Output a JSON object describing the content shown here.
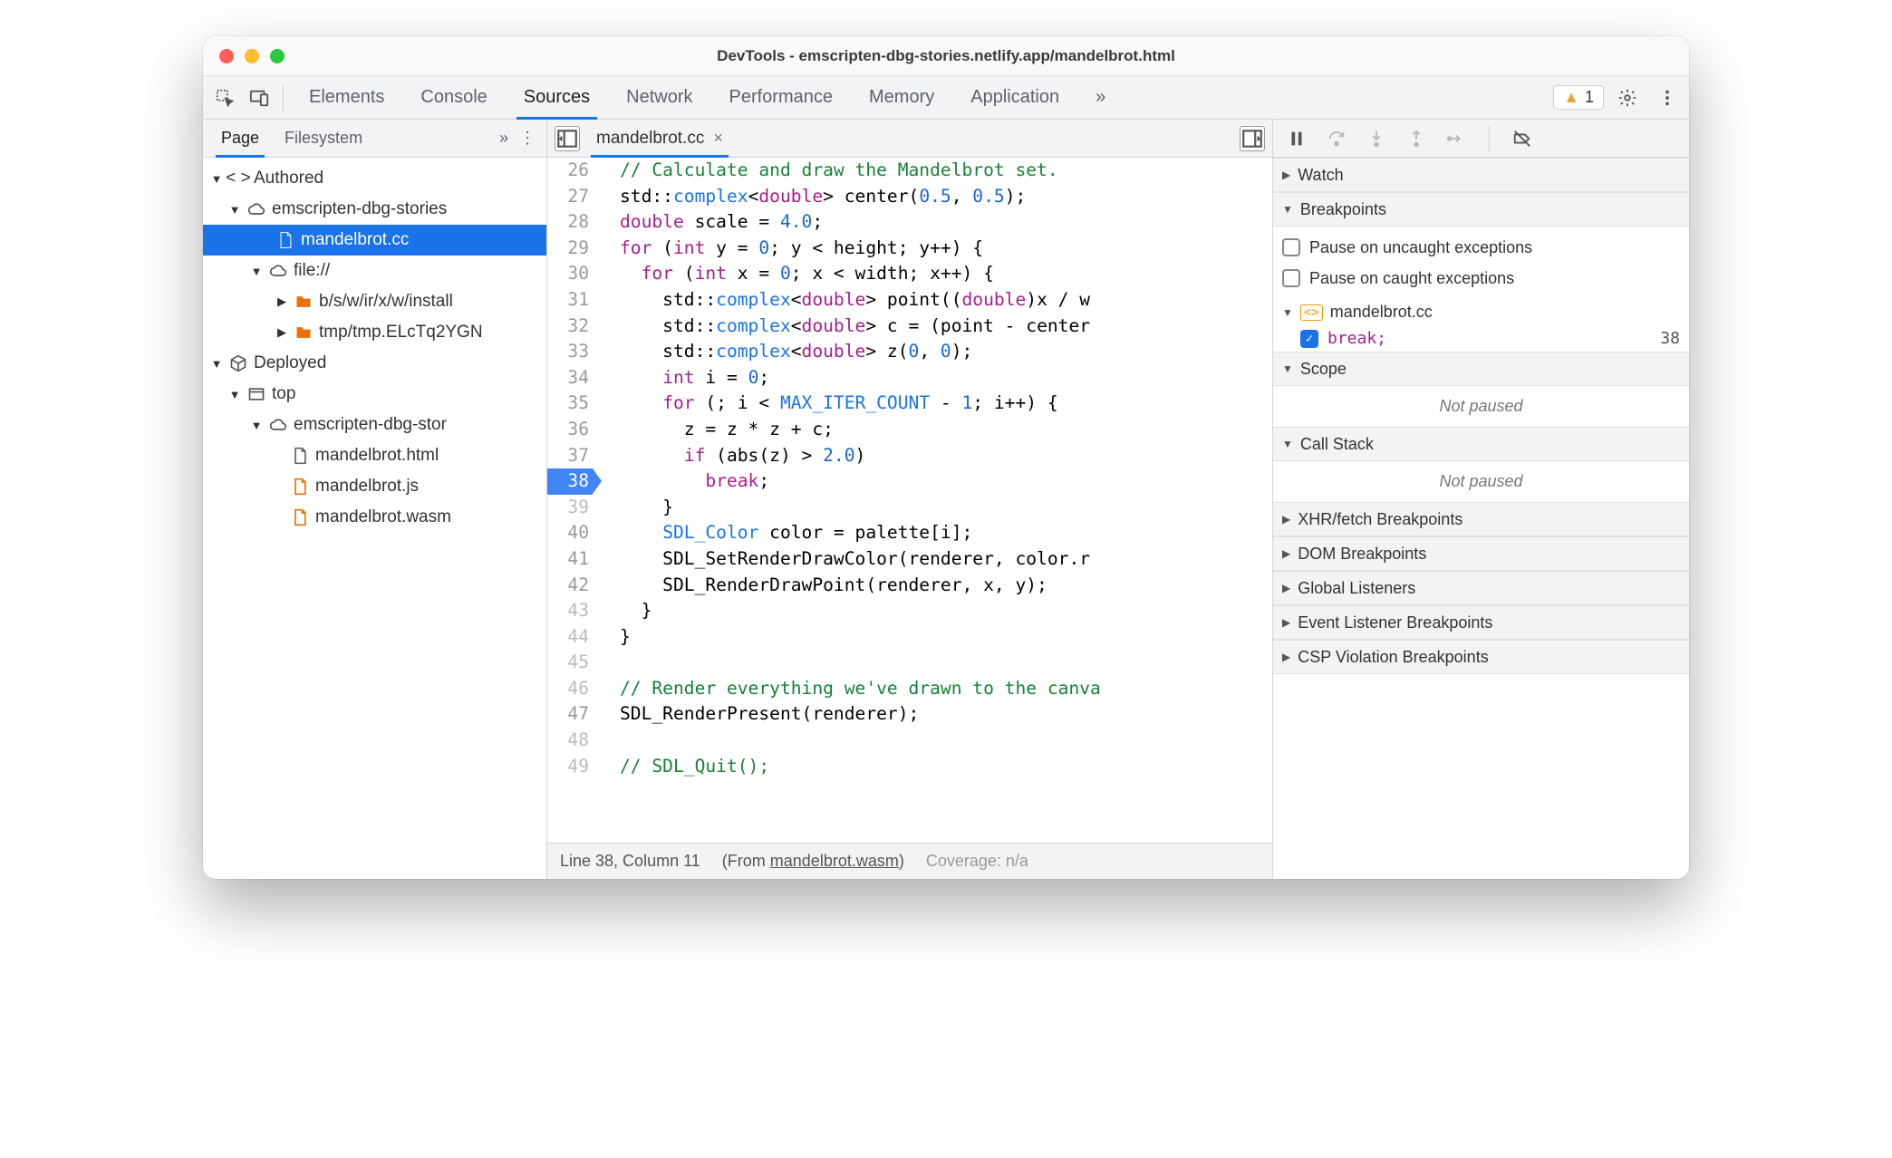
{
  "title": "DevTools - emscripten-dbg-stories.netlify.app/mandelbrot.html",
  "toolbar": {
    "panels": [
      "Elements",
      "Console",
      "Sources",
      "Network",
      "Performance",
      "Memory",
      "Application"
    ],
    "active": "Sources",
    "overflow": "»",
    "warning_count": "1"
  },
  "sidebar": {
    "tabs": [
      "Page",
      "Filesystem"
    ],
    "active": "Page",
    "overflow": "»",
    "tree": {
      "authored_label": "Authored",
      "origin1": "emscripten-dbg-stories",
      "file_sel": "mandelbrot.cc",
      "file_scheme": "file://",
      "dirs": [
        "b/s/w/ir/x/w/install",
        "tmp/tmp.ELcTq2YGN"
      ],
      "deployed_label": "Deployed",
      "top_label": "top",
      "origin2": "emscripten-dbg-stor",
      "deployed_files": [
        "mandelbrot.html",
        "mandelbrot.js",
        "mandelbrot.wasm"
      ]
    }
  },
  "editor": {
    "tab_name": "mandelbrot.cc",
    "status_lc": "Line 38, Column 11",
    "status_from_prefix": "(From ",
    "status_from_link": "mandelbrot.wasm",
    "status_from_suffix": ")",
    "status_cov": "Coverage: n/a",
    "first_line": 26,
    "breakpoint_line": 38,
    "dim_lines": [
      39,
      43,
      44,
      45,
      46,
      48,
      49
    ],
    "code": [
      {
        "n": 26,
        "h": "<span class='c-cm'>// Calculate and draw the Mandelbrot set.</span>"
      },
      {
        "n": 27,
        "h": "std::<span class='c-ty'>complex</span>&lt;<span class='c-kw'>double</span>&gt; center(<span class='c-num'>0.5</span>, <span class='c-num'>0.5</span>);"
      },
      {
        "n": 28,
        "h": "<span class='c-kw'>double</span> scale = <span class='c-num'>4.0</span>;"
      },
      {
        "n": 29,
        "h": "<span class='c-kw'>for</span> (<span class='c-kw'>int</span> y = <span class='c-num'>0</span>; y &lt; height; y++) {"
      },
      {
        "n": 30,
        "h": "  <span class='c-kw'>for</span> (<span class='c-kw'>int</span> x = <span class='c-num'>0</span>; x &lt; width; x++) {"
      },
      {
        "n": 31,
        "h": "    std::<span class='c-ty'>complex</span>&lt;<span class='c-kw'>double</span>&gt; point((<span class='c-kw'>double</span>)x / w"
      },
      {
        "n": 32,
        "h": "    std::<span class='c-ty'>complex</span>&lt;<span class='c-kw'>double</span>&gt; c = (point - center"
      },
      {
        "n": 33,
        "h": "    std::<span class='c-ty'>complex</span>&lt;<span class='c-kw'>double</span>&gt; z(<span class='c-num'>0</span>, <span class='c-num'>0</span>);"
      },
      {
        "n": 34,
        "h": "    <span class='c-kw'>int</span> i = <span class='c-num'>0</span>;"
      },
      {
        "n": 35,
        "h": "    <span class='c-kw'>for</span> (; i &lt; <span class='c-mac'>MAX_ITER_COUNT</span> - <span class='c-num'>1</span>; i++) {"
      },
      {
        "n": 36,
        "h": "      z = z * z + c;"
      },
      {
        "n": 37,
        "h": "      <span class='c-kw'>if</span> (abs(z) &gt; <span class='c-num'>2.0</span>)"
      },
      {
        "n": 38,
        "h": "        <span class='c-kw'>break</span>;"
      },
      {
        "n": 39,
        "h": "    }"
      },
      {
        "n": 40,
        "h": "    <span class='c-ty'>SDL_Color</span> color = palette[i];"
      },
      {
        "n": 41,
        "h": "    SDL_SetRenderDrawColor(renderer, color.r"
      },
      {
        "n": 42,
        "h": "    SDL_RenderDrawPoint(renderer, x, y);"
      },
      {
        "n": 43,
        "h": "  }"
      },
      {
        "n": 44,
        "h": "}"
      },
      {
        "n": 45,
        "h": ""
      },
      {
        "n": 46,
        "h": "<span class='c-cm'>// Render everything we've drawn to the canva</span>"
      },
      {
        "n": 47,
        "h": "SDL_RenderPresent(renderer);"
      },
      {
        "n": 48,
        "h": ""
      },
      {
        "n": 49,
        "h": "<span class='c-cm'>// SDL_Quit();</span>"
      }
    ]
  },
  "debugger": {
    "watch": "Watch",
    "breakpoints": "Breakpoints",
    "pause_uncaught": "Pause on uncaught exceptions",
    "pause_caught": "Pause on caught exceptions",
    "bp_file": "mandelbrot.cc",
    "bp_text": "break;",
    "bp_line": "38",
    "scope": "Scope",
    "callstack": "Call Stack",
    "not_paused": "Not paused",
    "xhr": "XHR/fetch Breakpoints",
    "dom": "DOM Breakpoints",
    "global": "Global Listeners",
    "evt": "Event Listener Breakpoints",
    "csp": "CSP Violation Breakpoints"
  }
}
